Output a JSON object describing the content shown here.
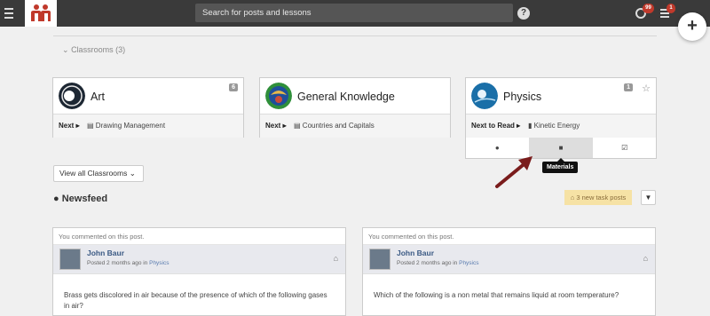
{
  "topbar": {
    "search_placeholder": "Search for posts and lessons",
    "help_glyph": "?",
    "notifications_count": "99",
    "tasks_count": "1",
    "fab_glyph": "+"
  },
  "classrooms": {
    "toggle_label": "Classrooms (3)",
    "cards": [
      {
        "title": "Art",
        "count": "6",
        "next_label": "Next ▸",
        "next_item": "Drawing Management"
      },
      {
        "title": "General Knowledge",
        "count": "",
        "next_label": "Next ▸",
        "next_item": "Countries and Capitals"
      },
      {
        "title": "Physics",
        "count": "1",
        "next_label": "Next to Read ▸",
        "next_item": "Kinetic Energy"
      }
    ],
    "view_all_label": "View all Classrooms"
  },
  "tooltip": "Materials",
  "newsfeed": {
    "title": "Newsfeed",
    "task_posts_label": "3 new task posts",
    "posts": [
      {
        "header": "You commented on this post.",
        "author": "John Baur",
        "meta_prefix": "Posted 2 months ago in ",
        "meta_class": "Physics",
        "body": "Brass gets discolored in air because of the presence of which of the following gases in air?"
      },
      {
        "header": "You commented on this post.",
        "author": "John Baur",
        "meta_prefix": "Posted 2 months ago in ",
        "meta_class": "Physics",
        "body": "Which of the following is a non metal that remains liquid at room temperature?"
      }
    ]
  },
  "colors": {
    "topbar": "#3a3a3a",
    "brand": "#c0392b",
    "task_badge": "#f6e2a5"
  }
}
